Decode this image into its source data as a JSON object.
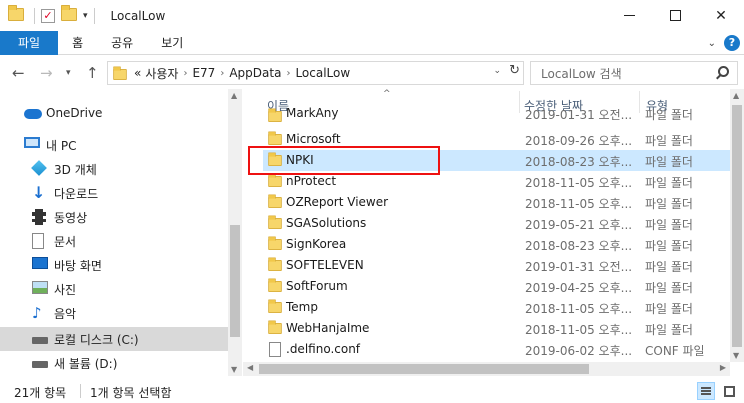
{
  "window": {
    "title": "LocalLow"
  },
  "ribbon": {
    "tabs": [
      "파일",
      "홈",
      "공유",
      "보기"
    ]
  },
  "address": {
    "prefix": "«",
    "crumbs": [
      "사용자",
      "E77",
      "AppData",
      "LocalLow"
    ]
  },
  "search": {
    "placeholder": "LocalLow 검색"
  },
  "nav": {
    "items": [
      {
        "label": "OneDrive",
        "icon": "onedrive-cloud-icon"
      },
      {
        "label": "내 PC",
        "icon": "pc-icon"
      },
      {
        "label": "3D 개체",
        "icon": "3d-objects-icon"
      },
      {
        "label": "다운로드",
        "icon": "download-icon"
      },
      {
        "label": "동영상",
        "icon": "video-icon"
      },
      {
        "label": "문서",
        "icon": "document-icon"
      },
      {
        "label": "바탕 화면",
        "icon": "desktop-icon"
      },
      {
        "label": "사진",
        "icon": "pictures-icon"
      },
      {
        "label": "음악",
        "icon": "music-icon"
      },
      {
        "label": "로컬 디스크 (C:)",
        "icon": "local-disk-icon",
        "selected": true
      },
      {
        "label": "새 볼륨 (D:)",
        "icon": "drive-icon"
      }
    ]
  },
  "columns": {
    "name": "이름",
    "date": "수정한 날짜",
    "type": "유형"
  },
  "files": [
    {
      "name": "MarkAny",
      "date": "2019-01-31 오전...",
      "type": "파일 폴더",
      "kind": "folder",
      "partial": true
    },
    {
      "name": "Microsoft",
      "date": "2018-09-26 오후...",
      "type": "파일 폴더",
      "kind": "folder"
    },
    {
      "name": "NPKI",
      "date": "2018-08-23 오후...",
      "type": "파일 폴더",
      "kind": "folder",
      "selected": true
    },
    {
      "name": "nProtect",
      "date": "2018-11-05 오후...",
      "type": "파일 폴더",
      "kind": "folder"
    },
    {
      "name": "OZReport Viewer",
      "date": "2018-11-05 오후...",
      "type": "파일 폴더",
      "kind": "folder"
    },
    {
      "name": "SGASolutions",
      "date": "2019-05-21 오후...",
      "type": "파일 폴더",
      "kind": "folder"
    },
    {
      "name": "SignKorea",
      "date": "2018-08-23 오후...",
      "type": "파일 폴더",
      "kind": "folder"
    },
    {
      "name": "SOFTELEVEN",
      "date": "2019-01-31 오전...",
      "type": "파일 폴더",
      "kind": "folder"
    },
    {
      "name": "SoftForum",
      "date": "2019-04-25 오후...",
      "type": "파일 폴더",
      "kind": "folder"
    },
    {
      "name": "Temp",
      "date": "2018-11-05 오후...",
      "type": "파일 폴더",
      "kind": "folder"
    },
    {
      "name": "WebHanjaIme",
      "date": "2018-11-05 오후...",
      "type": "파일 폴더",
      "kind": "folder"
    },
    {
      "name": ".delfino.conf",
      "date": "2019-06-02 오후...",
      "type": "CONF 파일",
      "kind": "file"
    }
  ],
  "status": {
    "count": "21개 항목",
    "selection": "1개 항목 선택함"
  },
  "colors": {
    "accent": "#1979ca",
    "selection": "#cce8ff",
    "highlight_box": "#ee1111"
  }
}
